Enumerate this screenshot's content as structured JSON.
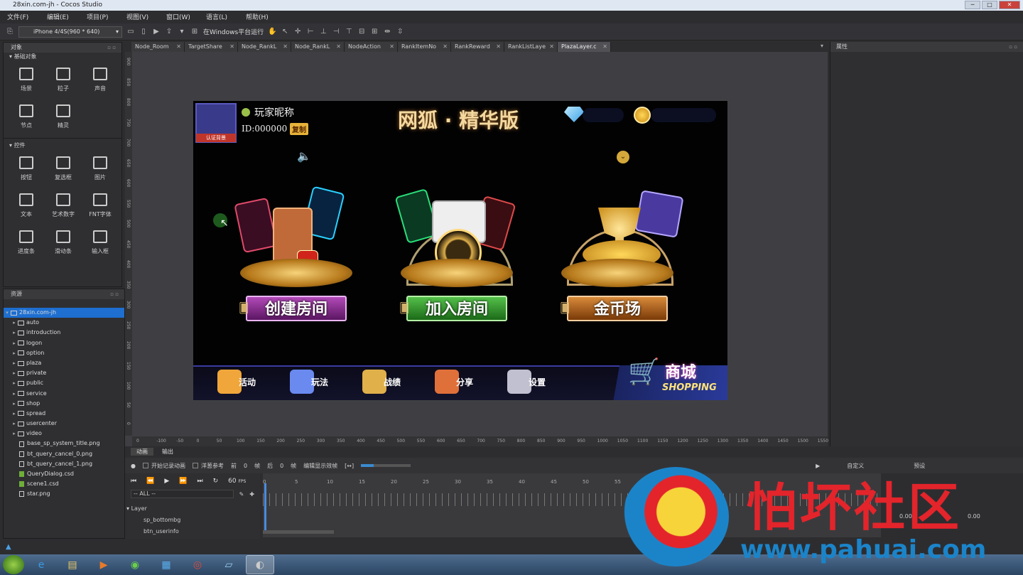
{
  "window": {
    "title": "28xin.com-jh - Cocos Studio"
  },
  "menu": [
    "文件(F)",
    "编辑(E)",
    "项目(P)",
    "视图(V)",
    "窗口(W)",
    "语言(L)",
    "帮助(H)"
  ],
  "toolbar": {
    "device": "iPhone 4/4S(960 * 640)",
    "run_label": "在Windows平台运行"
  },
  "objects_panel": {
    "title": "对象",
    "basic_header": "基础对象",
    "basic": [
      {
        "label": "场景",
        "icon": "map-icon"
      },
      {
        "label": "粒子",
        "icon": "particle-icon"
      },
      {
        "label": "声音",
        "icon": "sound-icon"
      },
      {
        "label": "节点",
        "icon": "node-icon"
      },
      {
        "label": "精灵",
        "icon": "sprite-icon"
      }
    ],
    "controls_header": "控件",
    "controls": [
      {
        "label": "按钮",
        "icon": "button-icon"
      },
      {
        "label": "复选框",
        "icon": "checkbox-icon"
      },
      {
        "label": "图片",
        "icon": "image-icon"
      },
      {
        "label": "文本",
        "icon": "text-icon"
      },
      {
        "label": "艺术数字",
        "icon": "atlas-number-icon"
      },
      {
        "label": "FNT字体",
        "icon": "fnt-font-icon"
      },
      {
        "label": "进度条",
        "icon": "progress-icon"
      },
      {
        "label": "滑动条",
        "icon": "slider-icon"
      },
      {
        "label": "输入框",
        "icon": "input-icon"
      }
    ]
  },
  "resources_panel": {
    "title": "资源",
    "root": "28xin.com-jh",
    "folders": [
      "auto",
      "introduction",
      "logon",
      "option",
      "plaza",
      "private",
      "public",
      "service",
      "shop",
      "spread",
      "usercenter",
      "video"
    ],
    "files": [
      {
        "name": "base_sp_system_title.png",
        "green": false
      },
      {
        "name": "bt_query_cancel_0.png",
        "green": false
      },
      {
        "name": "bt_query_cancel_1.png",
        "green": false
      },
      {
        "name": "QueryDialog.csd",
        "green": true
      },
      {
        "name": "scene1.csd",
        "green": true
      },
      {
        "name": "star.png",
        "green": false
      }
    ]
  },
  "tabs": [
    "Node_Room",
    "TargetShare",
    "Node_RankL",
    "Node_RankL",
    "NodeAction",
    "RankItemNo",
    "RankReward",
    "RankListLaye",
    "PlazaLayer.c"
  ],
  "properties_panel": {
    "title": "属性"
  },
  "ruler": {
    "h": [
      "0",
      "-100",
      "-50",
      "0",
      "50",
      "100",
      "150",
      "200",
      "250",
      "300",
      "350",
      "400",
      "450",
      "500",
      "550",
      "600",
      "650",
      "700",
      "750",
      "800",
      "850",
      "900",
      "950",
      "1000",
      "1050",
      "1100",
      "1150",
      "1200",
      "1250",
      "1300",
      "1350",
      "1400",
      "1450",
      "1500",
      "1550"
    ],
    "v": [
      "900",
      "850",
      "800",
      "750",
      "700",
      "650",
      "600",
      "550",
      "500",
      "450",
      "400",
      "350",
      "300",
      "250",
      "200",
      "150",
      "100",
      "50",
      "0"
    ]
  },
  "game": {
    "player_name": "玩家昵称",
    "player_id": "ID:000000",
    "copy_btn": "复制",
    "avatar_tag": "认证背景",
    "title": "网狐 · 精华版",
    "modes": [
      {
        "label": "创建房间",
        "color": "#7a2a8a"
      },
      {
        "label": "加入房间",
        "color": "#2f7a2a"
      },
      {
        "label": "金币场",
        "color": "#8a4a12"
      }
    ],
    "nav": [
      {
        "label": "活动",
        "icon": "gift-icon"
      },
      {
        "label": "玩法",
        "icon": "diamond-rules-icon"
      },
      {
        "label": "战绩",
        "icon": "star-medal-icon"
      },
      {
        "label": "分享",
        "icon": "lucky-cat-icon"
      },
      {
        "label": "设置",
        "icon": "gear-icon"
      }
    ],
    "shop_cn": "商城",
    "shop_en": "SHOPPING"
  },
  "bottom": {
    "tabs": [
      "动画",
      "输出"
    ],
    "toolbar": {
      "record": "开始记录动画",
      "onion": "洋葱参考",
      "onion_front": "前",
      "onion_front_val": "0",
      "onion_back": "帧",
      "onion_back_val2": "后",
      "onion_back_val": "0",
      "frame": "帧",
      "cache": "编辑显示效帧",
      "fps": "60",
      "fps_label": "FPS"
    },
    "filter": "-- ALL --",
    "layer": "Layer",
    "layer_items": [
      "sp_bottombg",
      "btn_userinfo"
    ],
    "timeline_marks": [
      "0",
      "5",
      "10",
      "15",
      "20",
      "25",
      "30",
      "35",
      "40",
      "45",
      "50",
      "55",
      "60"
    ],
    "right_labels": {
      "custom": "自定义",
      "preset": "预设",
      "v1": "0.00",
      "v2": "0.00"
    }
  },
  "watermark": {
    "text": "怕坏社区",
    "url": "www.pahuai.com"
  }
}
